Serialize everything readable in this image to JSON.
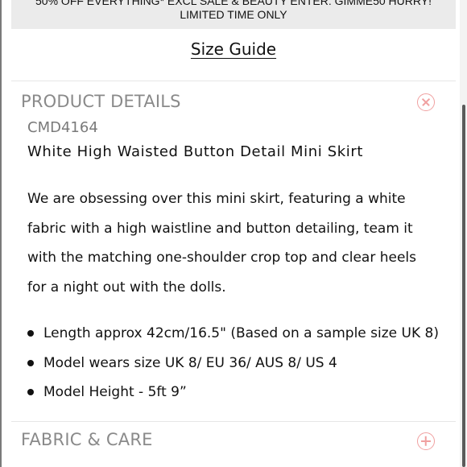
{
  "promo_banner": {
    "line1": "50% OFF EVERYTHING* EXCL SALE & BEAUTY ENTER: GIMME50 HURRY!",
    "line2": "LIMITED TIME ONLY"
  },
  "size_guide": {
    "label": "Size Guide"
  },
  "product_details": {
    "title": "PRODUCT DETAILS",
    "icon": "close-icon",
    "sku": "CMD4164",
    "name": "White High Waisted Button Detail Mini Skirt",
    "description": "We are obsessing over this mini skirt, featuring a white fabric with a high waistline and button detailing, team it with the matching one-shoulder crop top and clear heels for a night out with the dolls.",
    "bullets": [
      "Length approx 42cm/16.5\" (Based on a sample size UK 8)",
      "Model wears size UK 8/ EU 36/ AUS 8/ US 4",
      "Model Height - 5ft 9”"
    ]
  },
  "fabric_care": {
    "title": "FABRIC & CARE",
    "icon": "plus-icon"
  },
  "colors": {
    "accent_icon": "#f0a0a0",
    "section_title": "#8a8a8a",
    "banner_bg": "#ebebeb"
  }
}
